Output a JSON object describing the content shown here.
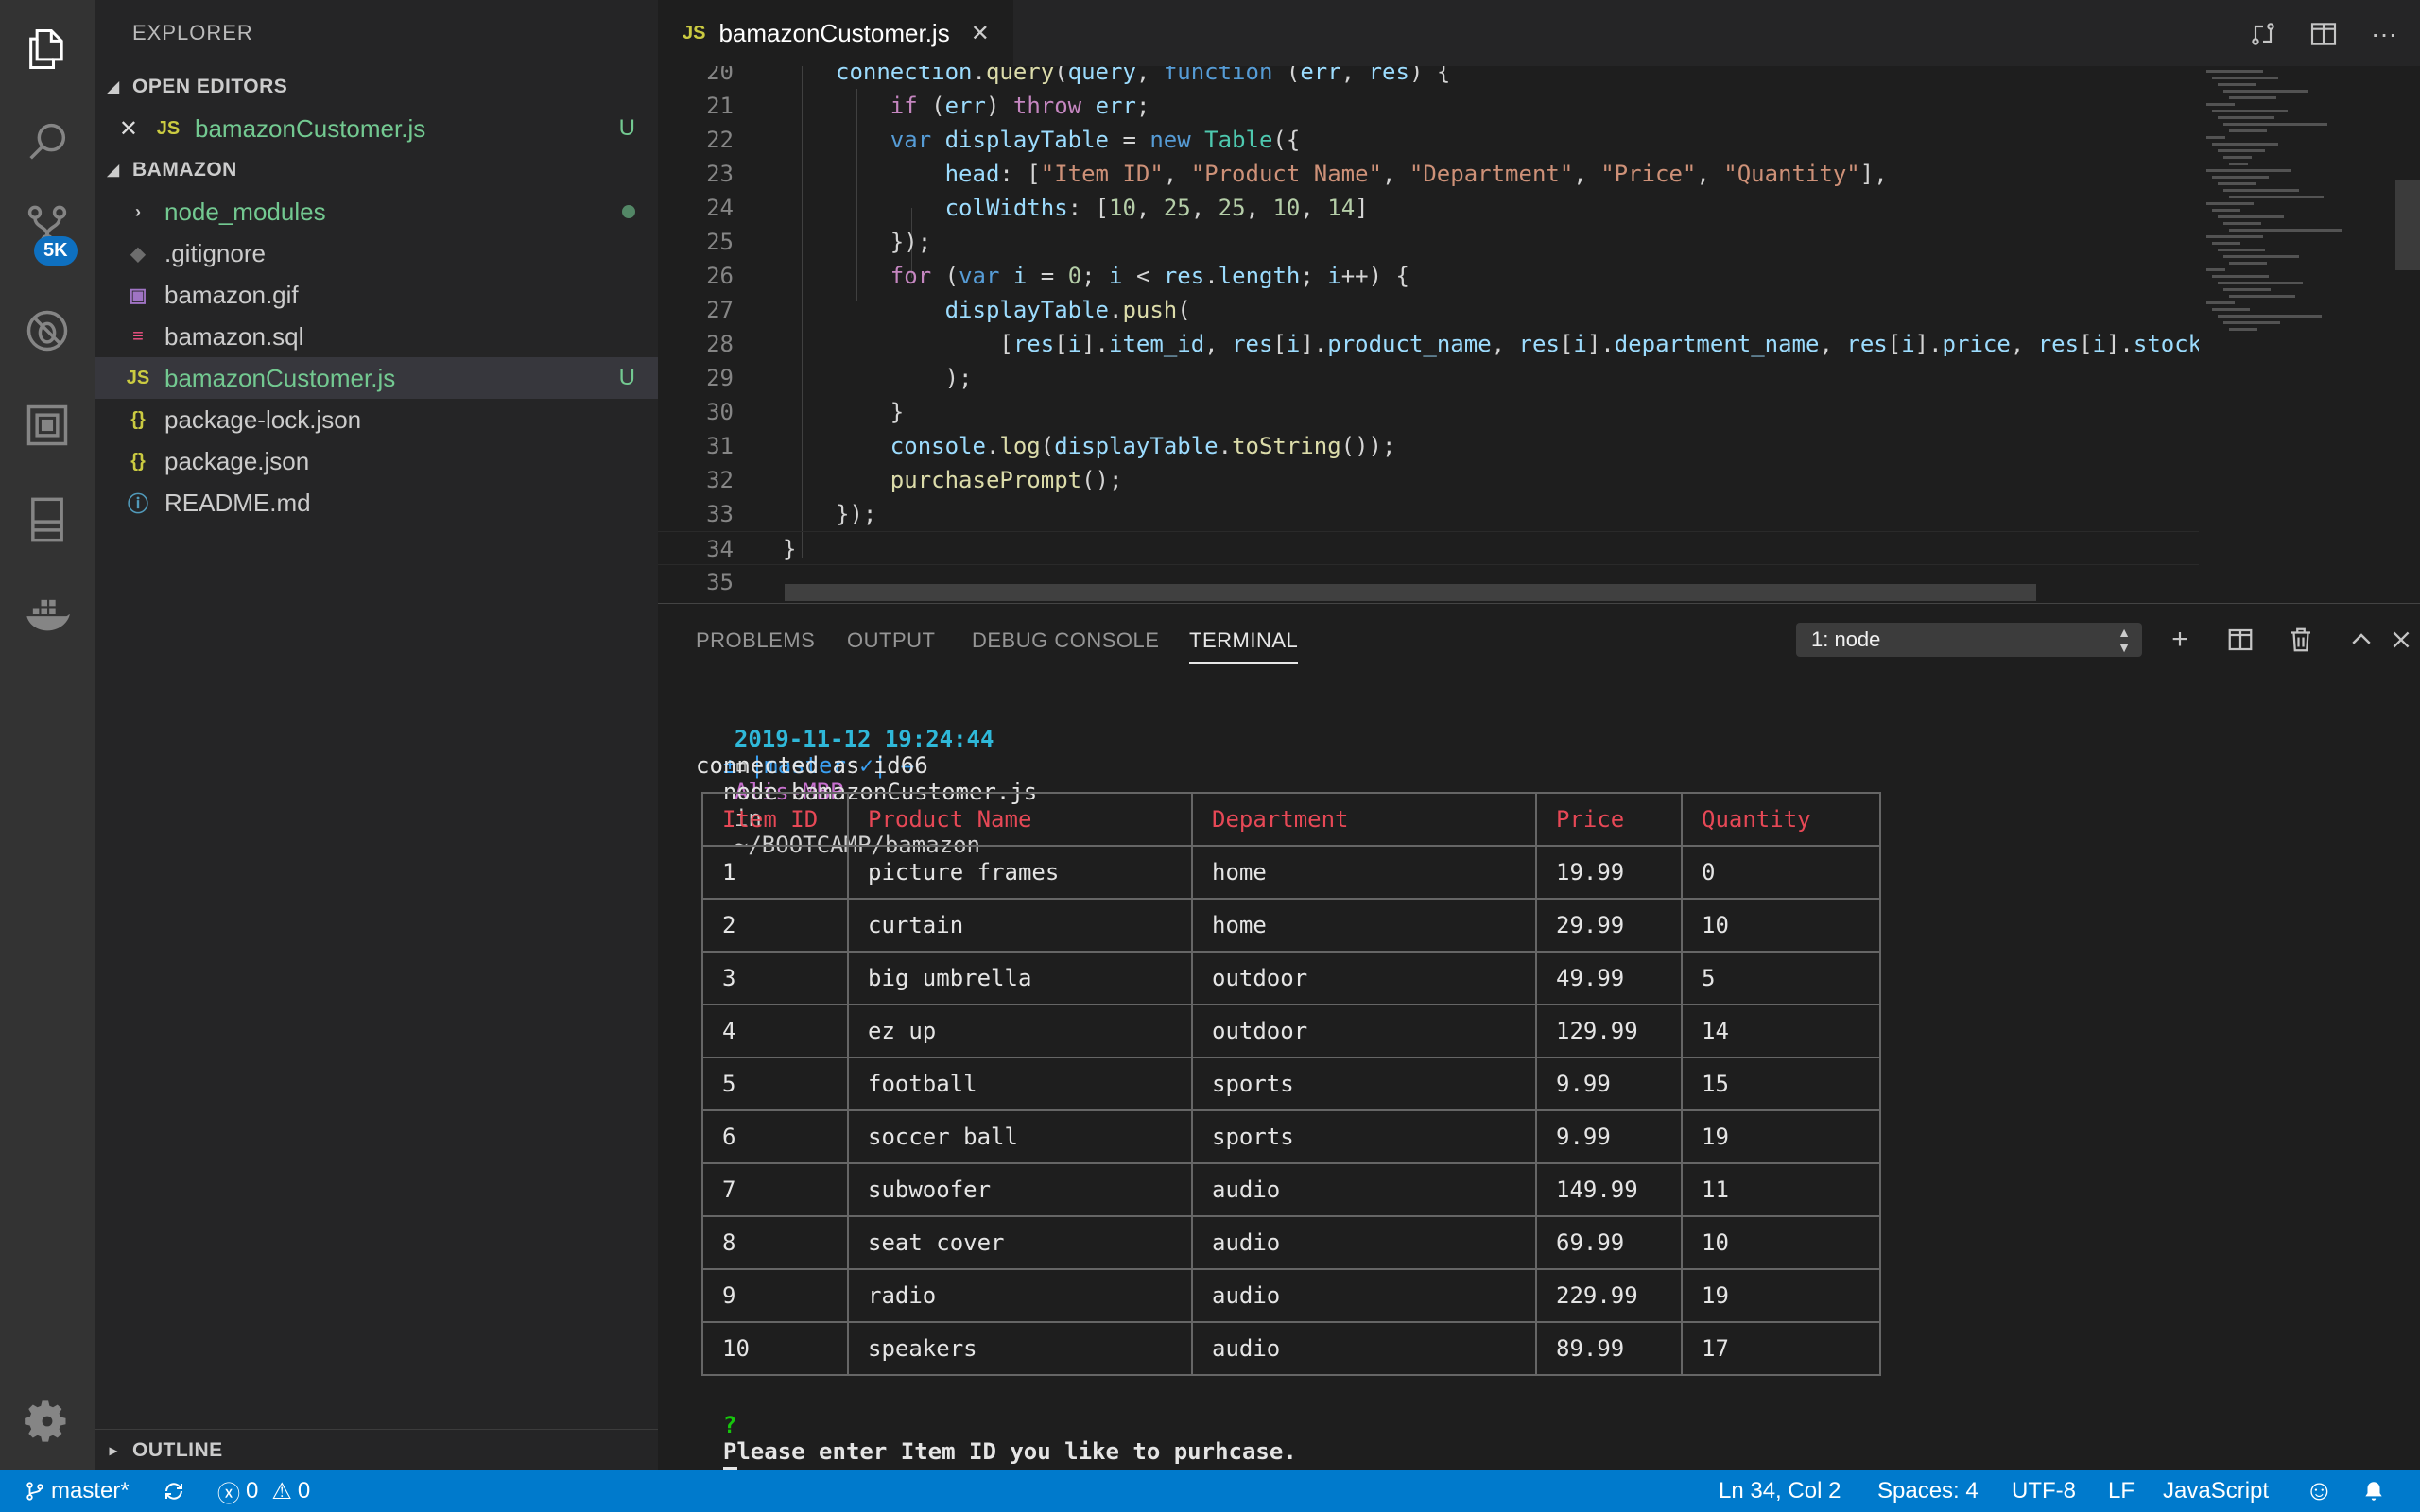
{
  "activity": {
    "icons": [
      "files-icon",
      "search-icon",
      "source-control-icon",
      "debug-icon",
      "extensions-icon",
      "remote-explorer-icon",
      "docker-icon",
      "settings-gear-icon"
    ],
    "scm_badge": "5K"
  },
  "sidebar": {
    "title": "EXPLORER",
    "open_editors_label": "OPEN EDITORS",
    "open_editor_file": "bamazonCustomer.js",
    "open_editor_status": "U",
    "project_label": "BAMAZON",
    "files": [
      {
        "name": "node_modules",
        "icon": "folder-chevron-icon"
      },
      {
        "name": ".gitignore",
        "icon": "git-icon"
      },
      {
        "name": "bamazon.gif",
        "icon": "image-icon"
      },
      {
        "name": "bamazon.sql",
        "icon": "database-icon"
      },
      {
        "name": "bamazonCustomer.js",
        "icon": "js-file-icon",
        "status": "U"
      },
      {
        "name": "package-lock.json",
        "icon": "json-icon"
      },
      {
        "name": "package.json",
        "icon": "json-icon"
      },
      {
        "name": "README.md",
        "icon": "info-icon"
      }
    ],
    "outline_label": "OUTLINE"
  },
  "editor": {
    "tab_label": "bamazonCustomer.js",
    "tab_type": "JS",
    "line_numbers": [
      "20",
      "21",
      "22",
      "23",
      "24",
      "25",
      "26",
      "27",
      "28",
      "29",
      "30",
      "31",
      "32",
      "33",
      "34",
      "35"
    ]
  },
  "panel": {
    "tabs": [
      "PROBLEMS",
      "OUTPUT",
      "DEBUG CONSOLE",
      "TERMINAL"
    ],
    "active_tab": "TERMINAL",
    "terminal_select": "1: node",
    "prompt_date": "2019-11-12 19:24:44",
    "prompt_host": "Alis-MBP",
    "prompt_in": "in",
    "prompt_path": "~/BOOTCAMP/bamazon",
    "prompt_branch": "± |master ✓| →",
    "command": "node bamazonCustomer.js",
    "connected": "connected as id66",
    "table_headers": [
      "Item ID",
      "Product Name",
      "Department",
      "Price",
      "Quantity"
    ],
    "table_rows": [
      [
        "1",
        "picture frames",
        "home",
        "19.99",
        "0"
      ],
      [
        "2",
        "curtain",
        "home",
        "29.99",
        "10"
      ],
      [
        "3",
        "big umbrella",
        "outdoor",
        "49.99",
        "5"
      ],
      [
        "4",
        "ez up",
        "outdoor",
        "129.99",
        "14"
      ],
      [
        "5",
        "football",
        "sports",
        "9.99",
        "15"
      ],
      [
        "6",
        "soccer ball",
        "sports",
        "9.99",
        "19"
      ],
      [
        "7",
        "subwoofer",
        "audio",
        "149.99",
        "11"
      ],
      [
        "8",
        "seat cover",
        "audio",
        "69.99",
        "10"
      ],
      [
        "9",
        "radio",
        "audio",
        "229.99",
        "19"
      ],
      [
        "10",
        "speakers",
        "audio",
        "89.99",
        "17"
      ]
    ],
    "question_mark": "?",
    "question": "Please enter Item ID you like to purhcase."
  },
  "status": {
    "branch": "master*",
    "errors": "0",
    "warnings": "0",
    "position": "Ln 34, Col 2",
    "spaces": "Spaces: 4",
    "encoding": "UTF-8",
    "eol": "LF",
    "language": "JavaScript"
  }
}
